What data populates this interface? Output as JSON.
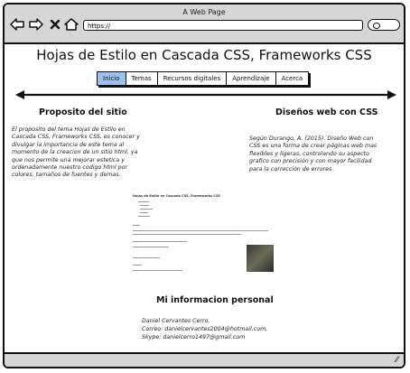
{
  "window": {
    "title": "A Web Page",
    "url": "https://"
  },
  "page": {
    "title": "Hojas de Estilo en Cascada CSS, Frameworks CSS",
    "tabs": [
      "Inicio",
      "Temas",
      "Recursos digitales",
      "Aprendizaje",
      "Acerca"
    ],
    "active_tab": "Inicio"
  },
  "left": {
    "heading": "Proposito del sitio",
    "lines": [
      "El proposito del tema Hojas de Estilo en",
      "Cascada CSS, Frameworks CSS, es conocer y",
      "divulgar la importancia de este tema al",
      "momento de la creacion de un sitio html, ya",
      "que nos permite una mejorar estetica y",
      "ordenadamente nuestro codigo html por",
      "colores, tamaños de fuentes y demas."
    ]
  },
  "right": {
    "heading": "Diseños web con CSS",
    "lines": [
      "Según Durango, A. (2015). Diseño Web con",
      "CSS es una forma de crear páginas web mas",
      "flexibles y ligeras, controlando su aspecto",
      "grafico con precisión y con mayor facilidad",
      "para la corrección de errores."
    ]
  },
  "thumbnail": {
    "heading": "Hojas de Estilo en Cascada CSS, Frameworks CSS"
  },
  "personal": {
    "heading": "Mi informacion personal",
    "name": "Daniel Cervantes Cerro,",
    "email": "Correo: danielcervantes2004@hotmail.com,",
    "skype": "Skype: danielcerro1497@gmail.com"
  }
}
